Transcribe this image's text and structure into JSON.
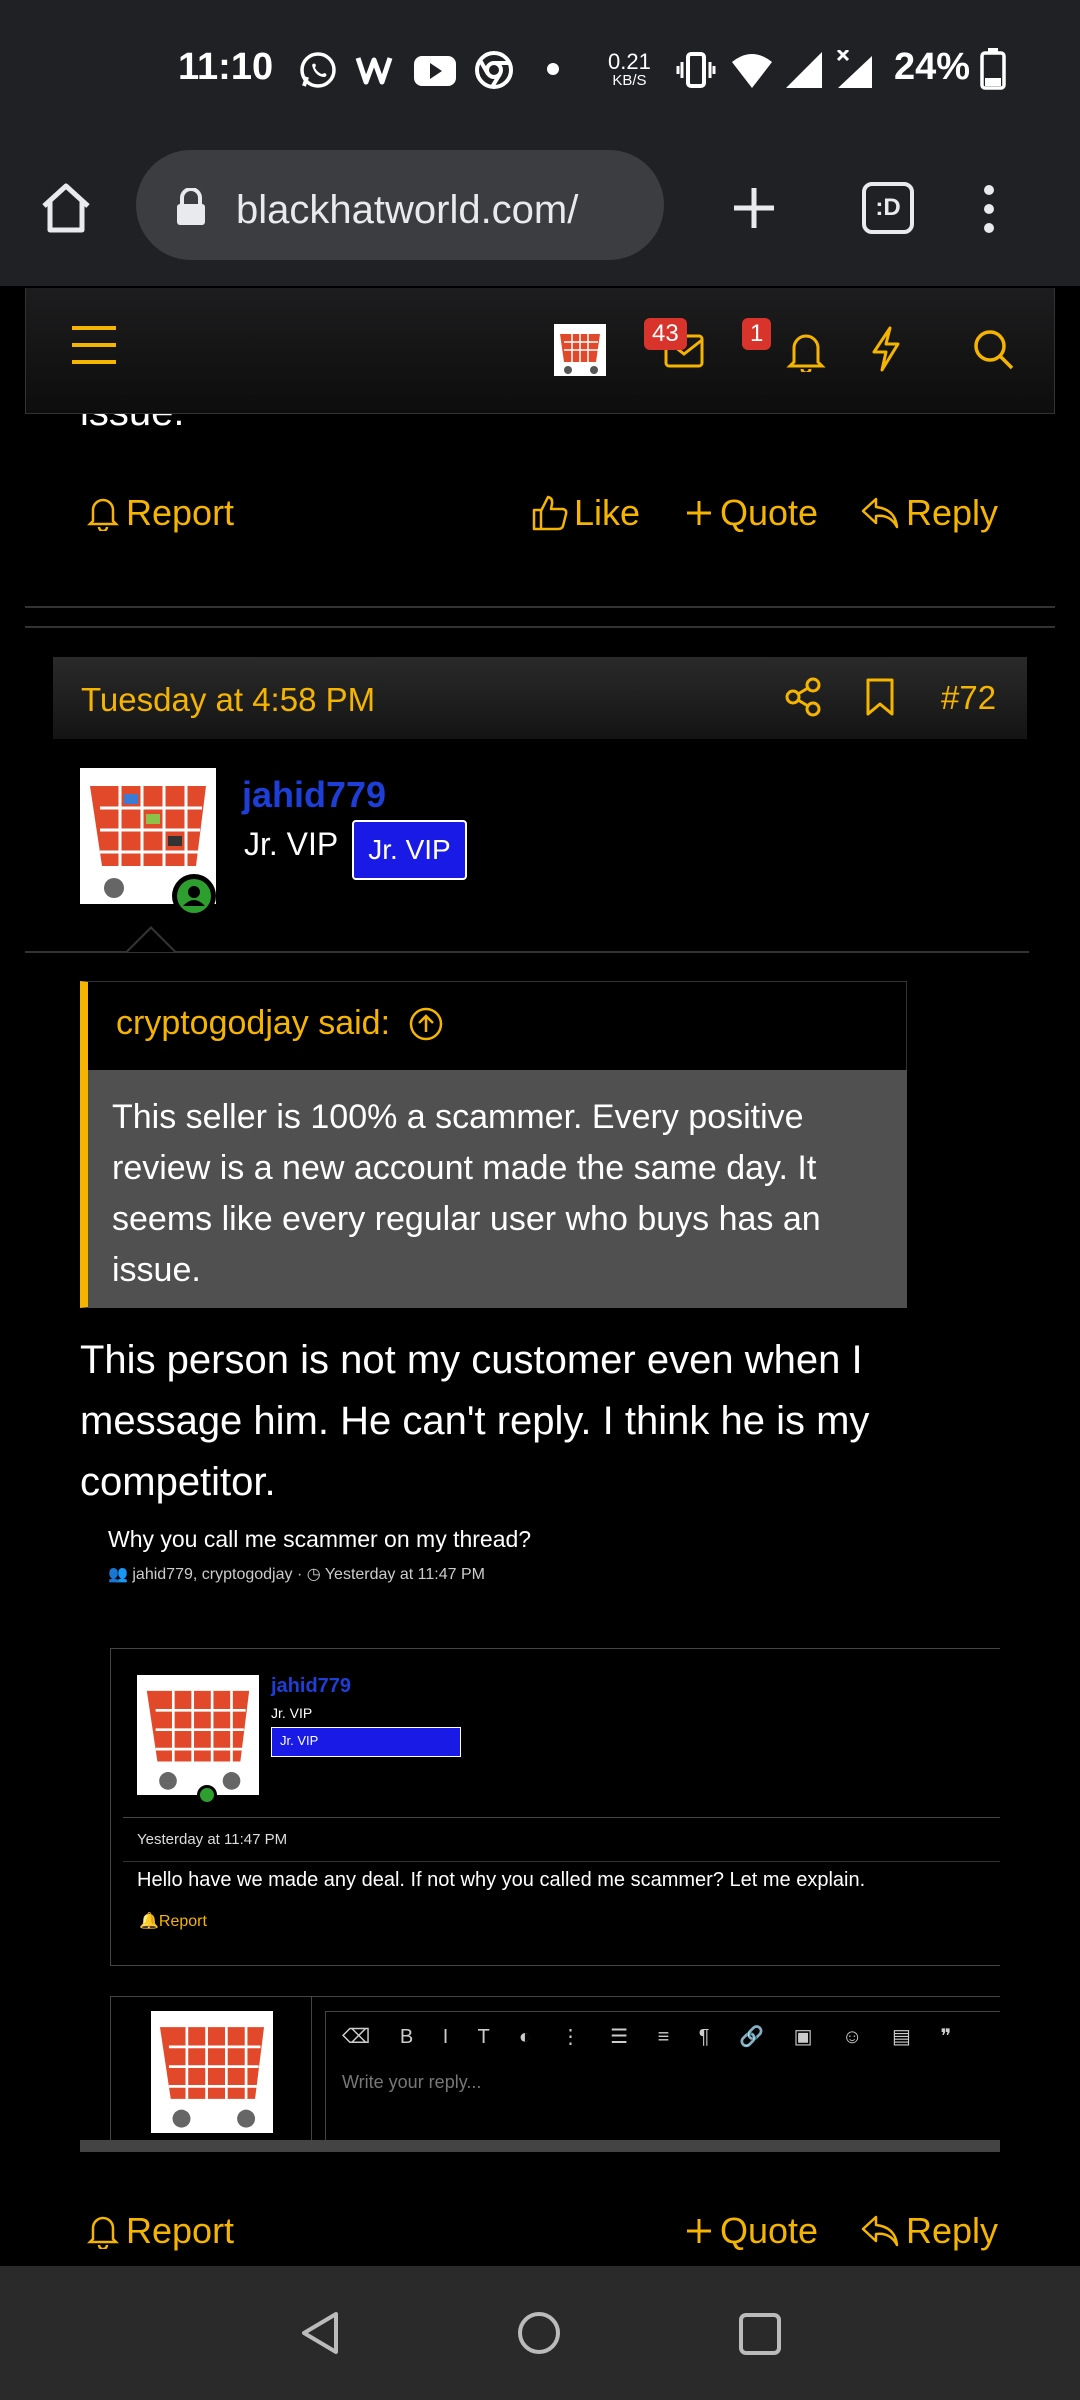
{
  "status_bar": {
    "time": "11:10",
    "net_speed_value": "0.21",
    "net_speed_unit": "KB/S",
    "battery": "24%",
    "icons": [
      "whatsapp-icon",
      "signal-app-icon",
      "youtube-icon",
      "chrome-icon",
      "dot-icon",
      "vibrate-icon",
      "wifi-icon",
      "cell-signal-icon",
      "cell-signal-x-icon",
      "battery-icon"
    ]
  },
  "browser": {
    "url": "blackhatworld.com/",
    "tab_count_label": ":D"
  },
  "site_nav": {
    "messages_count": "43",
    "alerts_count": "1"
  },
  "prev_post": {
    "trailing_text": "issue.",
    "report": "Report",
    "like": "Like",
    "quote": "Quote",
    "reply": "Reply"
  },
  "post": {
    "date": "Tuesday at 4:58 PM",
    "number": "#72",
    "username": "jahid779",
    "user_title": "Jr. VIP",
    "user_badge": "Jr. VIP",
    "quote_author": "cryptogodjay said:",
    "quote_text": "This seller is 100% a scammer. Every positive review is a new account made the same day. It seems like every regular user who buys has an issue.",
    "message": "This person is not my customer even when I message him. He can't reply. I think he is my competitor.",
    "report": "Report",
    "quote": "Quote",
    "reply": "Reply"
  },
  "embedded_screenshot": {
    "thread_title": "Why you call me scammer on my thread?",
    "participants": "jahid779, cryptogodjay",
    "meta_time": "Yesterday at 11:47 PM",
    "username": "jahid779",
    "user_title": "Jr. VIP",
    "user_badge": "Jr. VIP",
    "post_time": "Yesterday at 11:47 PM",
    "message": "Hello have we made any deal. If not why you called me scammer? Let me explain.",
    "report": "Report",
    "reply_placeholder": "Write your reply..."
  },
  "colors": {
    "accent": "#f5b400",
    "username": "#1e3ed8",
    "badge": "#1a1ae6",
    "alert_badge": "#d9342b"
  }
}
